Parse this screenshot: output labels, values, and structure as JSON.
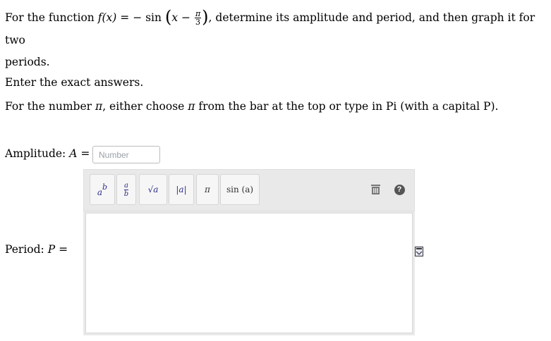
{
  "question": {
    "p1": "For the function",
    "fname": "f",
    "arg": "(x)",
    "eq": "=",
    "neg_sin": "− sin",
    "x": "x",
    "minus": "−",
    "frac_num": "π",
    "frac_den": "3",
    "p2": ", determine its amplitude and period, and then graph it for two",
    "p3": "periods."
  },
  "instructions": {
    "exact": "Enter the exact answers.",
    "pi_prefix": "For the number",
    "pi_symbol": "π",
    "pi_mid": ", either choose",
    "pi_symbol2": "π",
    "pi_suffix": "from the bar at the top or type in Pi (with a capital P)."
  },
  "amplitude": {
    "label": "Amplitude:",
    "var": "A",
    "eq": "=",
    "placeholder": "Number"
  },
  "toolbar": {
    "superscript_base": "a",
    "superscript_exp": "b",
    "fraction_num": "a",
    "fraction_den": "b",
    "sqrt_label": "√a",
    "abs_label": "|a|",
    "pi_label": "π",
    "sin_label": "sin (a)",
    "help_label": "?"
  },
  "period": {
    "label": "Period:",
    "var": "P",
    "eq": "="
  },
  "colors": {
    "toolbar_bg": "#e9e9e9",
    "button_bg": "#f6f6f6",
    "math_blue": "#2b2b8c",
    "placeholder_gray": "#9aa0a6"
  }
}
